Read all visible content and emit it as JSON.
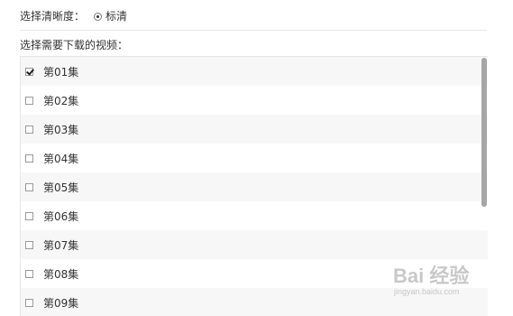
{
  "quality": {
    "label": "选择清晰度：",
    "option": "标清",
    "selected": true
  },
  "episodes": {
    "title": "选择需要下载的视频：",
    "items": [
      {
        "label": "第01集",
        "checked": true
      },
      {
        "label": "第02集",
        "checked": false
      },
      {
        "label": "第03集",
        "checked": false
      },
      {
        "label": "第04集",
        "checked": false
      },
      {
        "label": "第05集",
        "checked": false
      },
      {
        "label": "第06集",
        "checked": false
      },
      {
        "label": "第07集",
        "checked": false
      },
      {
        "label": "第08集",
        "checked": false
      },
      {
        "label": "第09集",
        "checked": false
      }
    ]
  },
  "watermark": {
    "logo": "Bai 经验",
    "url": "jingyan.baidu.com"
  }
}
